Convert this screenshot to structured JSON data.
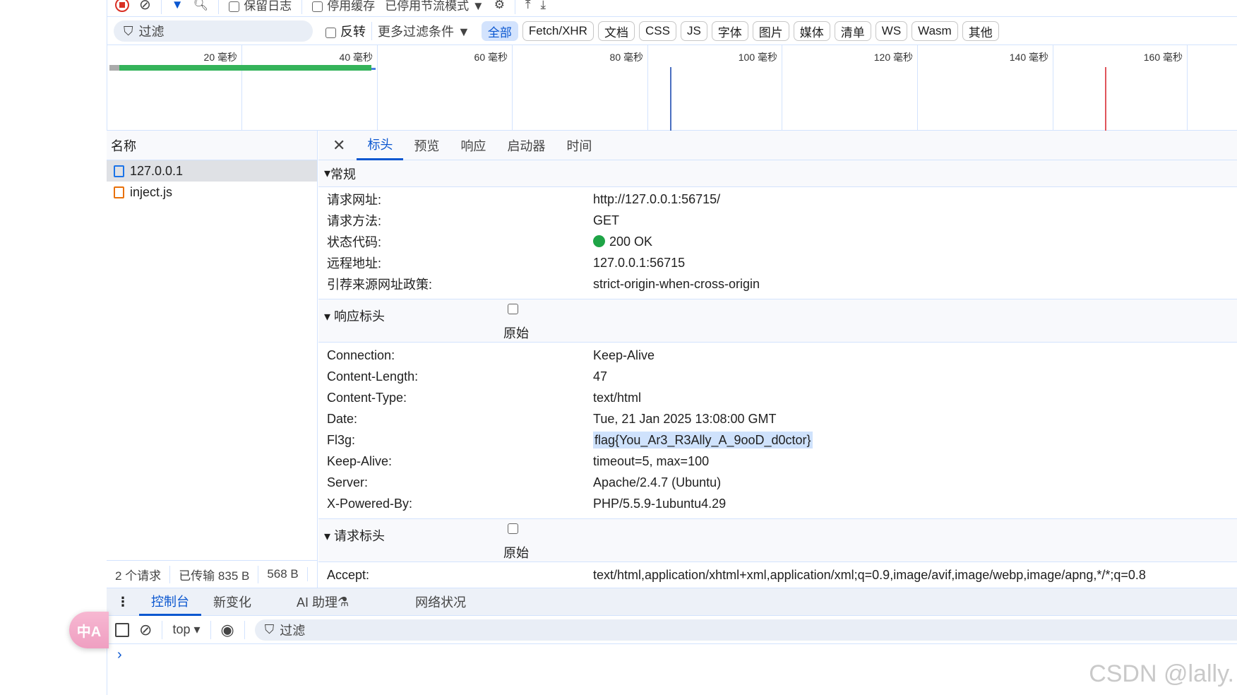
{
  "toolbar": {
    "preserve_log": "保留日志",
    "disable_cache": "停用缓存",
    "throttle": "已停用节流模式"
  },
  "filter": {
    "placeholder": "过滤",
    "invert": "反转",
    "more_filters": "更多过滤条件",
    "chips": [
      "全部",
      "Fetch/XHR",
      "文档",
      "CSS",
      "JS",
      "字体",
      "图片",
      "媒体",
      "清单",
      "WS",
      "Wasm",
      "其他"
    ]
  },
  "timeline": {
    "ticks": [
      "20 毫秒",
      "40 毫秒",
      "60 毫秒",
      "80 毫秒",
      "100 毫秒",
      "120 毫秒",
      "140 毫秒",
      "160 毫秒"
    ]
  },
  "requests": {
    "header": "名称",
    "items": [
      {
        "name": "127.0.0.1",
        "type": "document"
      },
      {
        "name": "inject.js",
        "type": "script"
      }
    ]
  },
  "status": {
    "count": "2 个请求",
    "transferred": "已传输 835 B",
    "resources": "568 B"
  },
  "detail": {
    "tabs": [
      "标头",
      "预览",
      "响应",
      "启动器",
      "时间"
    ],
    "general": {
      "title": "常规",
      "rows": [
        [
          "请求网址:",
          "http://127.0.0.1:56715/"
        ],
        [
          "请求方法:",
          "GET"
        ],
        [
          "状态代码:",
          "200 OK"
        ],
        [
          "远程地址:",
          "127.0.0.1:56715"
        ],
        [
          "引荐来源网址政策:",
          "strict-origin-when-cross-origin"
        ]
      ]
    },
    "response": {
      "title": "响应标头",
      "raw": "原始",
      "rows": [
        [
          "Connection:",
          "Keep-Alive"
        ],
        [
          "Content-Length:",
          "47"
        ],
        [
          "Content-Type:",
          "text/html"
        ],
        [
          "Date:",
          "Tue, 21 Jan 2025 13:08:00 GMT"
        ],
        [
          "Fl3g:",
          "flag{You_Ar3_R3Ally_A_9ooD_d0ctor}"
        ],
        [
          "Keep-Alive:",
          "timeout=5, max=100"
        ],
        [
          "Server:",
          "Apache/2.4.7 (Ubuntu)"
        ],
        [
          "X-Powered-By:",
          "PHP/5.5.9-1ubuntu4.29"
        ]
      ]
    },
    "request": {
      "title": "请求标头",
      "raw": "原始",
      "rows": [
        [
          "Accept:",
          "text/html,application/xhtml+xml,application/xml;q=0.9,image/avif,image/webp,image/apng,*/*;q=0.8"
        ]
      ]
    }
  },
  "drawer": {
    "tabs": [
      "控制台",
      "新变化",
      "AI 助理",
      "网络状况"
    ]
  },
  "console": {
    "context": "top",
    "filter": "过滤"
  },
  "translate": {
    "label": "中A"
  },
  "watermark": "CSDN @lally.",
  "colors": {
    "accent": "#0b57d0",
    "status_ok": "#1ea446",
    "bar": "#34b35a"
  }
}
